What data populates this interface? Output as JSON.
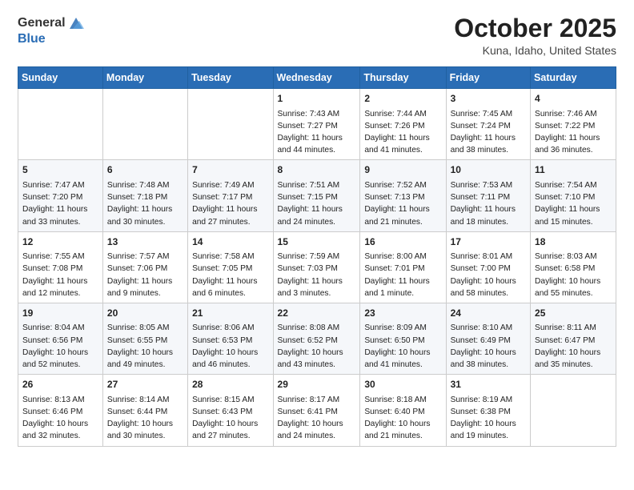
{
  "logo": {
    "general": "General",
    "blue": "Blue"
  },
  "title": {
    "month_year": "October 2025",
    "location": "Kuna, Idaho, United States"
  },
  "headers": [
    "Sunday",
    "Monday",
    "Tuesday",
    "Wednesday",
    "Thursday",
    "Friday",
    "Saturday"
  ],
  "weeks": [
    [
      {
        "day": "",
        "sunrise": "",
        "sunset": "",
        "daylight": ""
      },
      {
        "day": "",
        "sunrise": "",
        "sunset": "",
        "daylight": ""
      },
      {
        "day": "",
        "sunrise": "",
        "sunset": "",
        "daylight": ""
      },
      {
        "day": "1",
        "sunrise": "Sunrise: 7:43 AM",
        "sunset": "Sunset: 7:27 PM",
        "daylight": "Daylight: 11 hours and 44 minutes."
      },
      {
        "day": "2",
        "sunrise": "Sunrise: 7:44 AM",
        "sunset": "Sunset: 7:26 PM",
        "daylight": "Daylight: 11 hours and 41 minutes."
      },
      {
        "day": "3",
        "sunrise": "Sunrise: 7:45 AM",
        "sunset": "Sunset: 7:24 PM",
        "daylight": "Daylight: 11 hours and 38 minutes."
      },
      {
        "day": "4",
        "sunrise": "Sunrise: 7:46 AM",
        "sunset": "Sunset: 7:22 PM",
        "daylight": "Daylight: 11 hours and 36 minutes."
      }
    ],
    [
      {
        "day": "5",
        "sunrise": "Sunrise: 7:47 AM",
        "sunset": "Sunset: 7:20 PM",
        "daylight": "Daylight: 11 hours and 33 minutes."
      },
      {
        "day": "6",
        "sunrise": "Sunrise: 7:48 AM",
        "sunset": "Sunset: 7:18 PM",
        "daylight": "Daylight: 11 hours and 30 minutes."
      },
      {
        "day": "7",
        "sunrise": "Sunrise: 7:49 AM",
        "sunset": "Sunset: 7:17 PM",
        "daylight": "Daylight: 11 hours and 27 minutes."
      },
      {
        "day": "8",
        "sunrise": "Sunrise: 7:51 AM",
        "sunset": "Sunset: 7:15 PM",
        "daylight": "Daylight: 11 hours and 24 minutes."
      },
      {
        "day": "9",
        "sunrise": "Sunrise: 7:52 AM",
        "sunset": "Sunset: 7:13 PM",
        "daylight": "Daylight: 11 hours and 21 minutes."
      },
      {
        "day": "10",
        "sunrise": "Sunrise: 7:53 AM",
        "sunset": "Sunset: 7:11 PM",
        "daylight": "Daylight: 11 hours and 18 minutes."
      },
      {
        "day": "11",
        "sunrise": "Sunrise: 7:54 AM",
        "sunset": "Sunset: 7:10 PM",
        "daylight": "Daylight: 11 hours and 15 minutes."
      }
    ],
    [
      {
        "day": "12",
        "sunrise": "Sunrise: 7:55 AM",
        "sunset": "Sunset: 7:08 PM",
        "daylight": "Daylight: 11 hours and 12 minutes."
      },
      {
        "day": "13",
        "sunrise": "Sunrise: 7:57 AM",
        "sunset": "Sunset: 7:06 PM",
        "daylight": "Daylight: 11 hours and 9 minutes."
      },
      {
        "day": "14",
        "sunrise": "Sunrise: 7:58 AM",
        "sunset": "Sunset: 7:05 PM",
        "daylight": "Daylight: 11 hours and 6 minutes."
      },
      {
        "day": "15",
        "sunrise": "Sunrise: 7:59 AM",
        "sunset": "Sunset: 7:03 PM",
        "daylight": "Daylight: 11 hours and 3 minutes."
      },
      {
        "day": "16",
        "sunrise": "Sunrise: 8:00 AM",
        "sunset": "Sunset: 7:01 PM",
        "daylight": "Daylight: 11 hours and 1 minute."
      },
      {
        "day": "17",
        "sunrise": "Sunrise: 8:01 AM",
        "sunset": "Sunset: 7:00 PM",
        "daylight": "Daylight: 10 hours and 58 minutes."
      },
      {
        "day": "18",
        "sunrise": "Sunrise: 8:03 AM",
        "sunset": "Sunset: 6:58 PM",
        "daylight": "Daylight: 10 hours and 55 minutes."
      }
    ],
    [
      {
        "day": "19",
        "sunrise": "Sunrise: 8:04 AM",
        "sunset": "Sunset: 6:56 PM",
        "daylight": "Daylight: 10 hours and 52 minutes."
      },
      {
        "day": "20",
        "sunrise": "Sunrise: 8:05 AM",
        "sunset": "Sunset: 6:55 PM",
        "daylight": "Daylight: 10 hours and 49 minutes."
      },
      {
        "day": "21",
        "sunrise": "Sunrise: 8:06 AM",
        "sunset": "Sunset: 6:53 PM",
        "daylight": "Daylight: 10 hours and 46 minutes."
      },
      {
        "day": "22",
        "sunrise": "Sunrise: 8:08 AM",
        "sunset": "Sunset: 6:52 PM",
        "daylight": "Daylight: 10 hours and 43 minutes."
      },
      {
        "day": "23",
        "sunrise": "Sunrise: 8:09 AM",
        "sunset": "Sunset: 6:50 PM",
        "daylight": "Daylight: 10 hours and 41 minutes."
      },
      {
        "day": "24",
        "sunrise": "Sunrise: 8:10 AM",
        "sunset": "Sunset: 6:49 PM",
        "daylight": "Daylight: 10 hours and 38 minutes."
      },
      {
        "day": "25",
        "sunrise": "Sunrise: 8:11 AM",
        "sunset": "Sunset: 6:47 PM",
        "daylight": "Daylight: 10 hours and 35 minutes."
      }
    ],
    [
      {
        "day": "26",
        "sunrise": "Sunrise: 8:13 AM",
        "sunset": "Sunset: 6:46 PM",
        "daylight": "Daylight: 10 hours and 32 minutes."
      },
      {
        "day": "27",
        "sunrise": "Sunrise: 8:14 AM",
        "sunset": "Sunset: 6:44 PM",
        "daylight": "Daylight: 10 hours and 30 minutes."
      },
      {
        "day": "28",
        "sunrise": "Sunrise: 8:15 AM",
        "sunset": "Sunset: 6:43 PM",
        "daylight": "Daylight: 10 hours and 27 minutes."
      },
      {
        "day": "29",
        "sunrise": "Sunrise: 8:17 AM",
        "sunset": "Sunset: 6:41 PM",
        "daylight": "Daylight: 10 hours and 24 minutes."
      },
      {
        "day": "30",
        "sunrise": "Sunrise: 8:18 AM",
        "sunset": "Sunset: 6:40 PM",
        "daylight": "Daylight: 10 hours and 21 minutes."
      },
      {
        "day": "31",
        "sunrise": "Sunrise: 8:19 AM",
        "sunset": "Sunset: 6:38 PM",
        "daylight": "Daylight: 10 hours and 19 minutes."
      },
      {
        "day": "",
        "sunrise": "",
        "sunset": "",
        "daylight": ""
      }
    ]
  ]
}
